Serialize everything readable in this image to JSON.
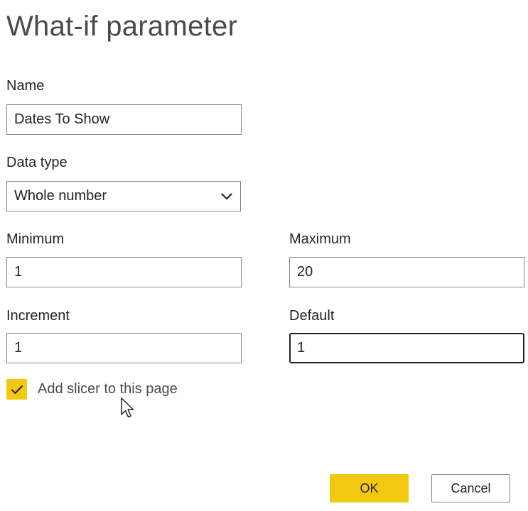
{
  "dialog": {
    "title": "What-if parameter"
  },
  "form": {
    "name": {
      "label": "Name",
      "value": "Dates To Show"
    },
    "data_type": {
      "label": "Data type",
      "selected": "Whole number",
      "icon": "chevron-down-icon"
    },
    "minimum": {
      "label": "Minimum",
      "value": "1"
    },
    "maximum": {
      "label": "Maximum",
      "value": "20"
    },
    "increment": {
      "label": "Increment",
      "value": "1"
    },
    "default": {
      "label": "Default",
      "value": "1"
    },
    "add_slicer": {
      "label": "Add slicer to this page",
      "checked": true,
      "icon": "checkmark-icon"
    }
  },
  "buttons": {
    "ok_label": "OK",
    "cancel_label": "Cancel"
  },
  "colors": {
    "accent": "#f2c811",
    "text": "#252423",
    "border": "#8a8886"
  }
}
